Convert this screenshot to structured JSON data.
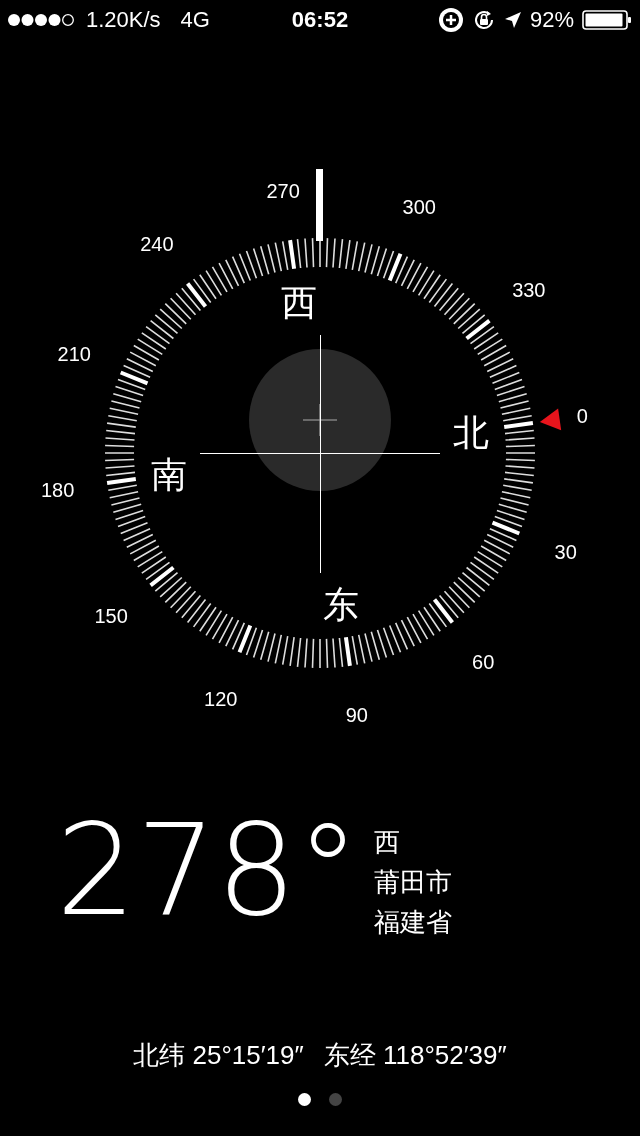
{
  "status_bar": {
    "speed": "1.20K/s",
    "network": "4G",
    "time": "06:52",
    "battery": "92%"
  },
  "compass": {
    "dial_labels": [
      "0",
      "30",
      "60",
      "90",
      "120",
      "150",
      "180",
      "210",
      "240",
      "270",
      "300",
      "330"
    ],
    "cardinals": [
      "北",
      "东",
      "南",
      "西"
    ]
  },
  "reading": {
    "heading": "278°",
    "direction": "西",
    "city": "莆田市",
    "province": "福建省"
  },
  "coordinates": {
    "latitude": "北纬 25°15′19″",
    "longitude": "东经 118°52′39″"
  },
  "page_dots": [
    {
      "selected": true
    },
    {
      "selected": false
    }
  ]
}
